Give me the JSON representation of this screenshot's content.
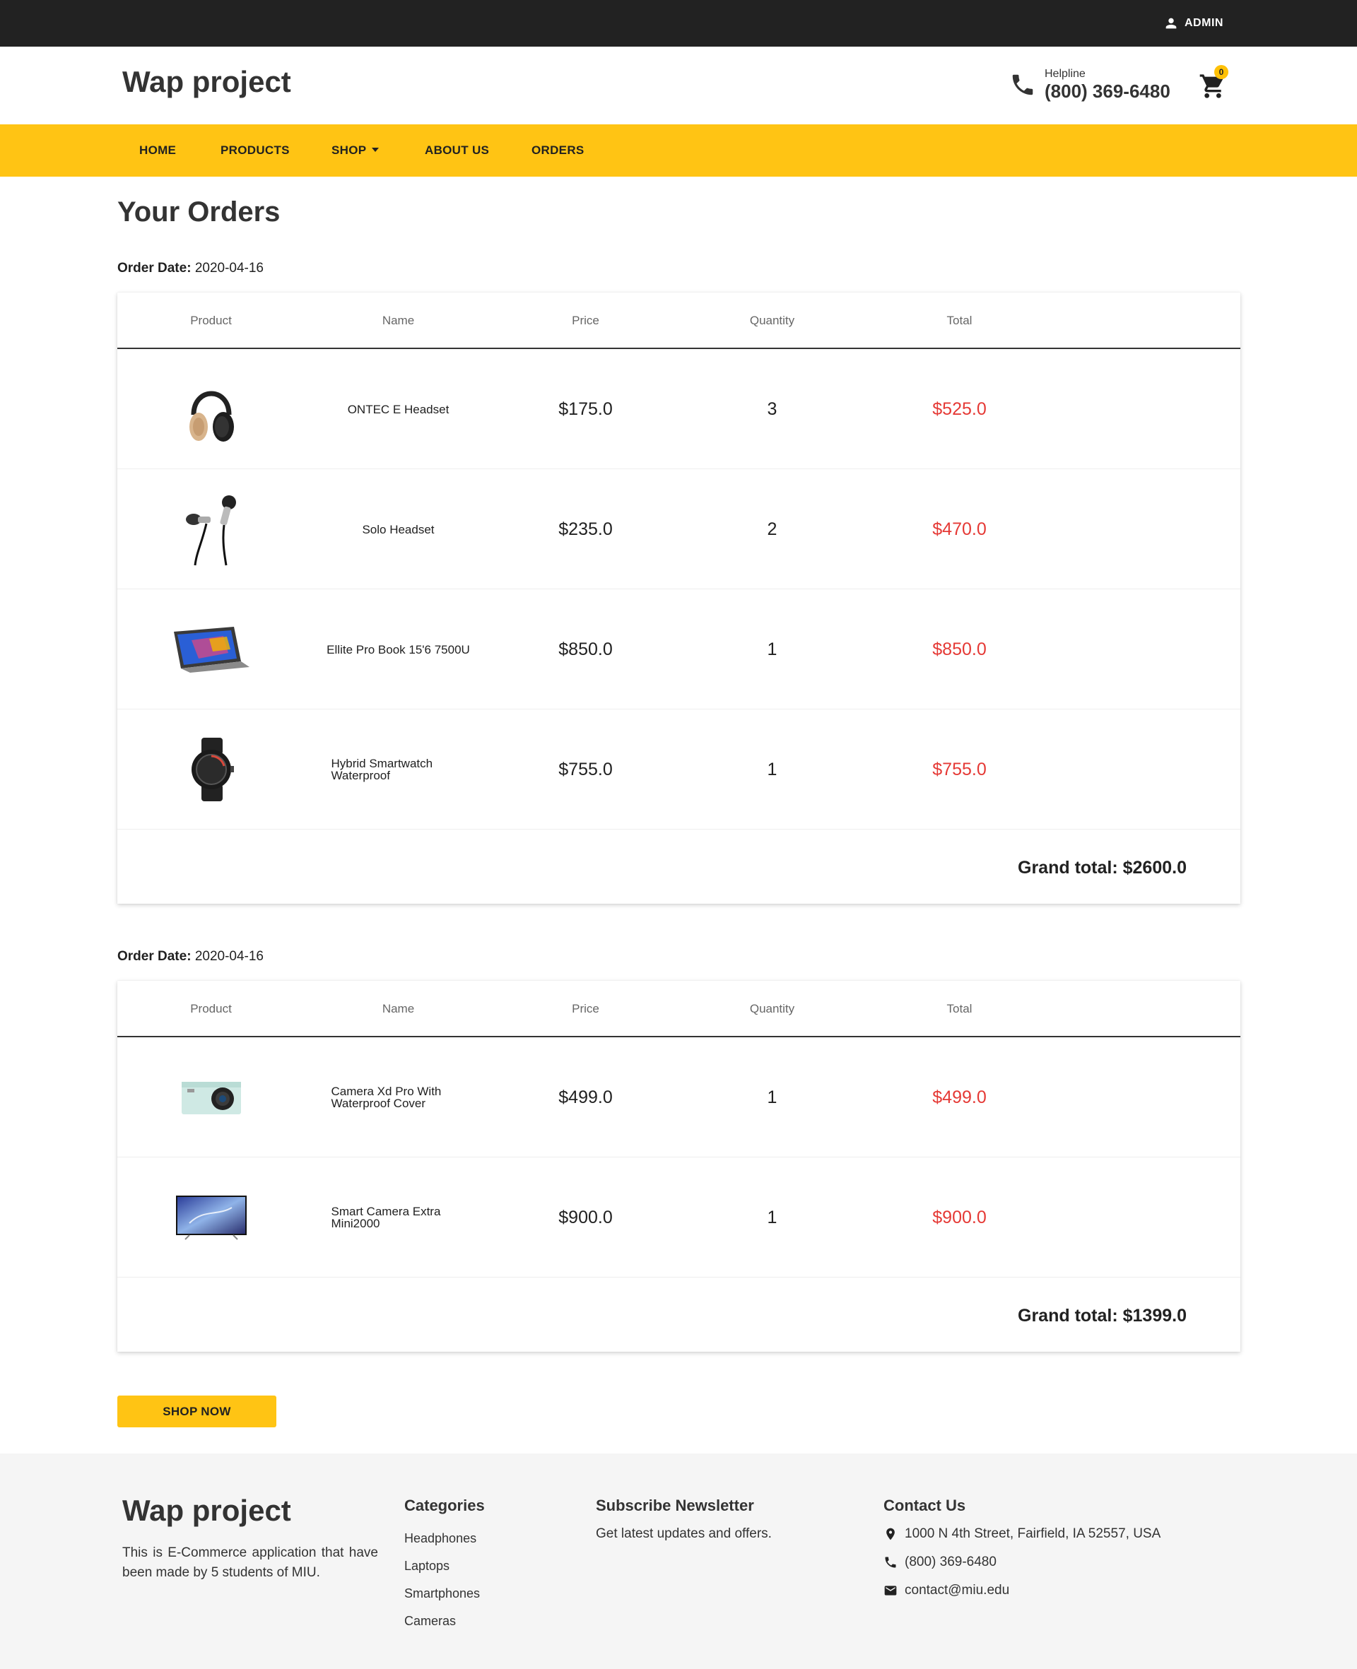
{
  "topbar": {
    "admin_label": "ADMIN",
    "user_icon": "person-icon"
  },
  "header": {
    "brand": "Wap project",
    "helpline_label": "Helpline",
    "helpline_phone": "(800) 369-6480",
    "cart_count": "0"
  },
  "nav": {
    "items": [
      {
        "label": "HOME"
      },
      {
        "label": "PRODUCTS"
      },
      {
        "label": "SHOP"
      },
      {
        "label": "ABOUT US"
      },
      {
        "label": "ORDERS"
      }
    ]
  },
  "main": {
    "title": "Your Orders",
    "order_date_label": "Order Date:",
    "columns": [
      "Product",
      "Name",
      "Price",
      "Quantity",
      "Total"
    ],
    "grand_total_label": "Grand total:",
    "orders": [
      {
        "date": "2020-04-16",
        "items": [
          {
            "name": "ONTEC E Headset",
            "price": "$175.0",
            "quantity": "3",
            "total": "$525.0",
            "image": "headphones-image"
          },
          {
            "name": "Solo Headset",
            "price": "$235.0",
            "quantity": "2",
            "total": "$470.0",
            "image": "earphones-image"
          },
          {
            "name": "Ellite Pro Book 15'6 7500U",
            "price": "$850.0",
            "quantity": "1",
            "total": "$850.0",
            "image": "laptop-image"
          },
          {
            "name": "Hybrid Smartwatch Waterproof",
            "price": "$755.0",
            "quantity": "1",
            "total": "$755.0",
            "image": "smartwatch-image"
          }
        ],
        "grand_total": "$2600.0"
      },
      {
        "date": "2020-04-16",
        "items": [
          {
            "name": "Camera Xd Pro With Waterproof Cover",
            "price": "$499.0",
            "quantity": "1",
            "total": "$499.0",
            "image": "camera-image"
          },
          {
            "name": "Smart Camera Extra Mini2000",
            "price": "$900.0",
            "quantity": "1",
            "total": "$900.0",
            "image": "tv-image"
          }
        ],
        "grand_total": "$1399.0"
      }
    ],
    "shop_now": "SHOP NOW"
  },
  "footer": {
    "brand": "Wap project",
    "description": "This is E-Commerce application that have been made by 5 students of MIU.",
    "categories_title": "Categories",
    "categories": [
      "Headphones",
      "Laptops",
      "Smartphones",
      "Cameras"
    ],
    "newsletter_title": "Subscribe Newsletter",
    "newsletter_text": "Get latest updates and offers.",
    "contact_title": "Contact Us",
    "address": "1000 N 4th Street, Fairfield, IA 52557, USA",
    "phone": "(800) 369-6480",
    "email": "contact@miu.edu"
  },
  "colors": {
    "accent": "#ffc414",
    "topbar": "#222222",
    "total_red": "#e53935",
    "footer_bg": "#f5f5f5"
  }
}
